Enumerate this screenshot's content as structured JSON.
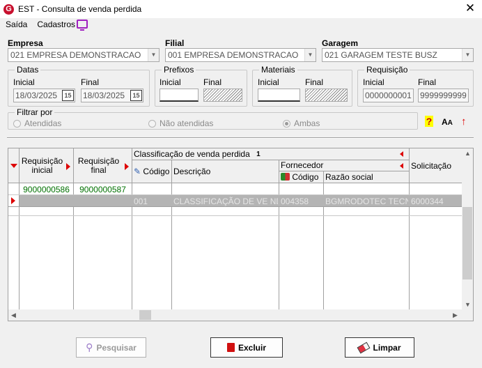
{
  "window": {
    "title": "EST - Consulta de venda perdida",
    "app_icon": "G"
  },
  "menu": {
    "saida": "Saída",
    "cadastros": "Cadastros"
  },
  "empresa": {
    "label": "Empresa",
    "value": "021 EMPRESA DEMONSTRACAO"
  },
  "filial": {
    "label": "Filial",
    "value": "001 EMPRESA DEMONSTRACAO"
  },
  "garagem": {
    "label": "Garagem",
    "value": "021 GARAGEM TESTE BUSZ"
  },
  "datas": {
    "title": "Datas",
    "inicial_label": "Inicial",
    "inicial_value": "18/03/2025",
    "final_label": "Final",
    "final_value": "18/03/2025",
    "cal": "15"
  },
  "prefixos": {
    "title": "Prefixos",
    "inicial_label": "Inicial",
    "final_label": "Final"
  },
  "materiais": {
    "title": "Materiais",
    "inicial_label": "Inicial",
    "final_label": "Final"
  },
  "requisicao": {
    "title": "Requisição",
    "inicial_label": "Inicial",
    "inicial_value": "0000000001",
    "final_label": "Final",
    "final_value": "9999999999"
  },
  "filtro": {
    "title": "Filtrar por",
    "opt1": "Atendidas",
    "opt2": "Não atendidas",
    "opt3": "Ambas"
  },
  "grid": {
    "col_req_inicial": "Requisição inicial",
    "col_req_final": "Requisição final",
    "group_classificacao": "Classificação de venda perdida",
    "group_num": "1",
    "col_codigo": "Código",
    "col_descricao": "Descrição",
    "group_fornecedor": "Fornecedor",
    "col_forn_codigo": "Código",
    "col_razao": "Razão social",
    "col_solicitacao": "Solicitação",
    "filter_row": {
      "req_inicial": "9000000586",
      "req_final": "9000000587"
    },
    "data_row": {
      "codigo": "001",
      "descricao": "CLASSIFICAÇÃO DE VE ND...",
      "forn_codigo": "004358",
      "razao": "BGMRODOTEC TECN...",
      "solicitacao": "6000344"
    }
  },
  "buttons": {
    "pesquisar": "Pesquisar",
    "excluir": "Excluir",
    "limpar": "Limpar"
  }
}
